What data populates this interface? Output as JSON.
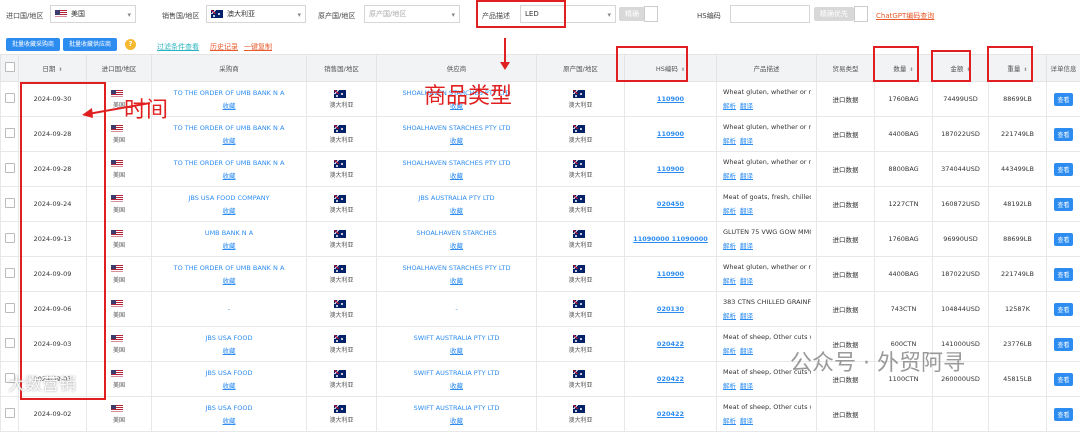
{
  "filters": {
    "importer_label": "进口国/地区",
    "importer_value": "美国",
    "seller_label": "销售国/地区",
    "seller_value": "澳大利亚",
    "origin_label": "原产国/地区",
    "origin_placeholder": "原产国/地区",
    "product_label": "产品描述",
    "product_value": "LED",
    "precise_label": "精确",
    "hs_label": "HS编码",
    "hs_precise_label": "精确优先",
    "chatgpt_link": "ChatGPT编码查询"
  },
  "toolbar": {
    "btn_batch_buyer": "批量收藏采购商",
    "btn_batch_supplier": "批量收藏供应商",
    "help": "?",
    "link_filter": "过滤条件查看",
    "link_history": "历史记录",
    "link_copy": "一键复制"
  },
  "columns": [
    "日期",
    "进口国/地区",
    "采购商",
    "销售国/地区",
    "供应商",
    "原产国/地区",
    "HS编码",
    "产品描述",
    "贸易类型",
    "数量",
    "金额",
    "重量",
    "详单信息"
  ],
  "sort_icon": "⬍",
  "labels": {
    "favorite": "收藏",
    "analyze": "解析",
    "translate": "翻译",
    "detail": "查看"
  },
  "rows": [
    {
      "date": "2024-09-30",
      "imp": "美国",
      "buyer": "TO THE ORDER OF UMB BANK N A",
      "seller": "澳大利亚",
      "supplier": "SHOALHAVEN STARCHES PTY LTD",
      "origin": "澳大利亚",
      "hs": "110900",
      "desc": "Wheat gluten, whether or not",
      "trade": "进口数据",
      "qty": "1760BAG",
      "amt": "74499USD",
      "wt": "88699LB"
    },
    {
      "date": "2024-09-28",
      "imp": "美国",
      "buyer": "TO THE ORDER OF UMB BANK N A",
      "seller": "澳大利亚",
      "supplier": "SHOALHAVEN STARCHES PTY LTD",
      "origin": "澳大利亚",
      "hs": "110900",
      "desc": "Wheat gluten, whether or not",
      "trade": "进口数据",
      "qty": "4400BAG",
      "amt": "187022USD",
      "wt": "221749LB"
    },
    {
      "date": "2024-09-28",
      "imp": "美国",
      "buyer": "TO THE ORDER OF UMB BANK N A",
      "seller": "澳大利亚",
      "supplier": "SHOALHAVEN STARCHES PTY LTD",
      "origin": "澳大利亚",
      "hs": "110900",
      "desc": "Wheat gluten, whether or not",
      "trade": "进口数据",
      "qty": "8800BAG",
      "amt": "374044USD",
      "wt": "443499LB"
    },
    {
      "date": "2024-09-24",
      "imp": "美国",
      "buyer": "JBS USA FOOD COMPANY",
      "seller": "澳大利亚",
      "supplier": "JBS AUSTRALIA PTY LTD",
      "origin": "澳大利亚",
      "hs": "020450",
      "desc": "Meat of goats, fresh, chilled or",
      "trade": "进口数据",
      "qty": "1227CTN",
      "amt": "160872USD",
      "wt": "48192LB"
    },
    {
      "date": "2024-09-13",
      "imp": "美国",
      "buyer": "UMB BANK N A",
      "seller": "澳大利亚",
      "supplier": "SHOALHAVEN STARCHES",
      "origin": "澳大利亚",
      "hs": "11090000 11090000",
      "desc": "GLUTEN 75 VWG GOW MMG",
      "trade": "进口数据",
      "qty": "1760BAG",
      "amt": "96990USD",
      "wt": "88699LB"
    },
    {
      "date": "2024-09-09",
      "imp": "美国",
      "buyer": "TO THE ORDER OF UMB BANK N A",
      "seller": "澳大利亚",
      "supplier": "SHOALHAVEN STARCHES PTY LTD",
      "origin": "澳大利亚",
      "hs": "110900",
      "desc": "Wheat gluten, whether or not",
      "trade": "进口数据",
      "qty": "4400BAG",
      "amt": "187022USD",
      "wt": "221749LB"
    },
    {
      "date": "2024-09-06",
      "imp": "美国",
      "buyer": "-",
      "seller": "澳大利亚",
      "supplier": "-",
      "origin": "澳大利亚",
      "hs": "020130",
      "desc": "383 CTNS CHILLED GRAINF",
      "trade": "进口数据",
      "qty": "743CTN",
      "amt": "104844USD",
      "wt": "12587K"
    },
    {
      "date": "2024-09-03",
      "imp": "美国",
      "buyer": "JBS USA FOOD",
      "seller": "澳大利亚",
      "supplier": "SWIFT AUSTRALIA PTY LTD",
      "origin": "澳大利亚",
      "hs": "020422",
      "desc": "Meat of sheep, Other cuts with",
      "trade": "进口数据",
      "qty": "600CTN",
      "amt": "141000USD",
      "wt": "23776LB"
    },
    {
      "date": "2024-09-03",
      "imp": "美国",
      "buyer": "JBS USA FOOD",
      "seller": "澳大利亚",
      "supplier": "SWIFT AUSTRALIA PTY LTD",
      "origin": "澳大利亚",
      "hs": "020422",
      "desc": "Meat of sheep, Other cuts with",
      "trade": "进口数据",
      "qty": "1100CTN",
      "amt": "260000USD",
      "wt": "45815LB"
    },
    {
      "date": "2024-09-02",
      "imp": "美国",
      "buyer": "JBS USA FOOD",
      "seller": "澳大利亚",
      "supplier": "SWIFT AUSTRALIA PTY LTD",
      "origin": "澳大利亚",
      "hs": "020422",
      "desc": "Meat of sheep, Other cuts with",
      "trade": "进口数据",
      "qty": "",
      "amt": "",
      "wt": ""
    }
  ],
  "annotations": {
    "time": "时间",
    "product_type": "商品类型",
    "colors": {
      "red": "#e02020",
      "blue": "#2d8cf0"
    }
  },
  "watermarks": {
    "bottom_left": "大数营销",
    "bottom_right": "公众号 · 外贸阿寻"
  }
}
